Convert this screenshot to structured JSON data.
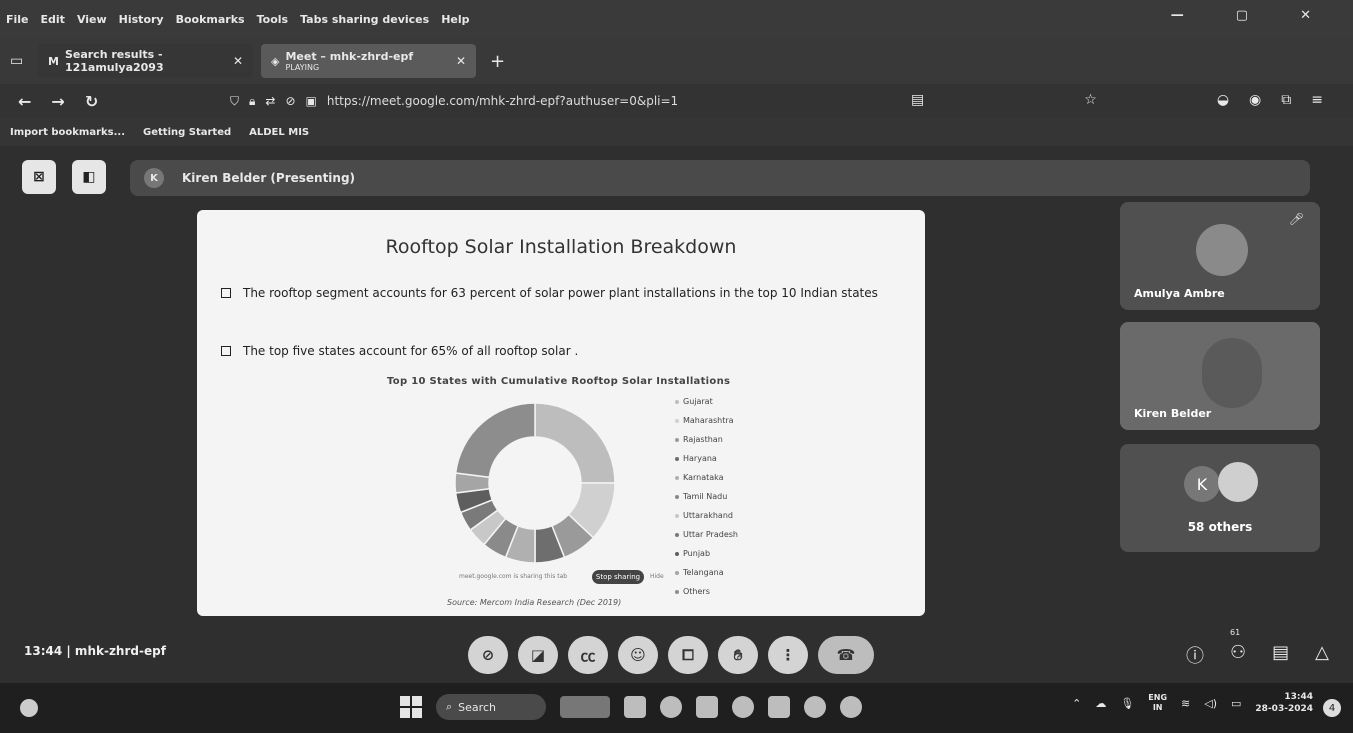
{
  "menubar": {
    "items": [
      "File",
      "Edit",
      "View",
      "History",
      "Bookmarks",
      "Tools",
      "Tabs sharing devices",
      "Help"
    ],
    "window_controls": [
      "—",
      "▢",
      "✕"
    ]
  },
  "tabs": [
    {
      "title": "Search results - 121amulya2093",
      "sub": "",
      "active": false
    },
    {
      "title": "Meet – mhk-zhrd-epf",
      "sub": "PLAYING",
      "active": true
    }
  ],
  "url": "https://meet.google.com/mhk-zhrd-epf?authuser=0&pli=1",
  "bookmarks": [
    "Import bookmarks...",
    "Getting Started",
    "ALDEL MIS"
  ],
  "presenter": {
    "initial": "K",
    "label": "Kiren Belder (Presenting)"
  },
  "slide": {
    "title": "Rooftop Solar Installation Breakdown",
    "bullet1": "The rooftop segment accounts for 63 percent of solar power plant installations in the top 10 Indian states",
    "bullet2": "The top five states account for 65% of all rooftop solar  ."
  },
  "chart_data": {
    "type": "pie",
    "title": "Top 10 States with Cumulative Rooftop Solar Installations",
    "categories": [
      "Gujarat",
      "Maharashtra",
      "Rajasthan",
      "Haryana",
      "Karnataka",
      "Tamil Nadu",
      "Uttarakhand",
      "Uttar Pradesh",
      "Punjab",
      "Telangana",
      "Others"
    ],
    "values": [
      25,
      12,
      7,
      6,
      6,
      5,
      4,
      4,
      4,
      4,
      23
    ],
    "colors": [
      "#bdbdbd",
      "#d0d0d0",
      "#9a9a9a",
      "#6e6e6e",
      "#b0b0b0",
      "#8a8a8a",
      "#c8c8c8",
      "#7a7a7a",
      "#5e5e5e",
      "#a5a5a5",
      "#8d8d8d"
    ],
    "legend_position": "right",
    "source": "Source: Mercom India Research (Dec 2019)"
  },
  "share_bar": {
    "note": "meet.google.com is sharing this tab",
    "stop": "Stop sharing",
    "hide": "Hide"
  },
  "participants": [
    {
      "name": "Amulya Ambre",
      "muted": true
    },
    {
      "name": "Kiren Belder",
      "muted": false
    }
  ],
  "others": {
    "initial": "K",
    "label": "58 others"
  },
  "meeting_code": "13:44 | mhk-zhrd-epf",
  "participant_count": "61",
  "taskbar": {
    "search": "Search",
    "lang_top": "ENG",
    "lang_bottom": "IN",
    "time": "13:44",
    "date": "28-03-2024",
    "notification_count": "4"
  }
}
